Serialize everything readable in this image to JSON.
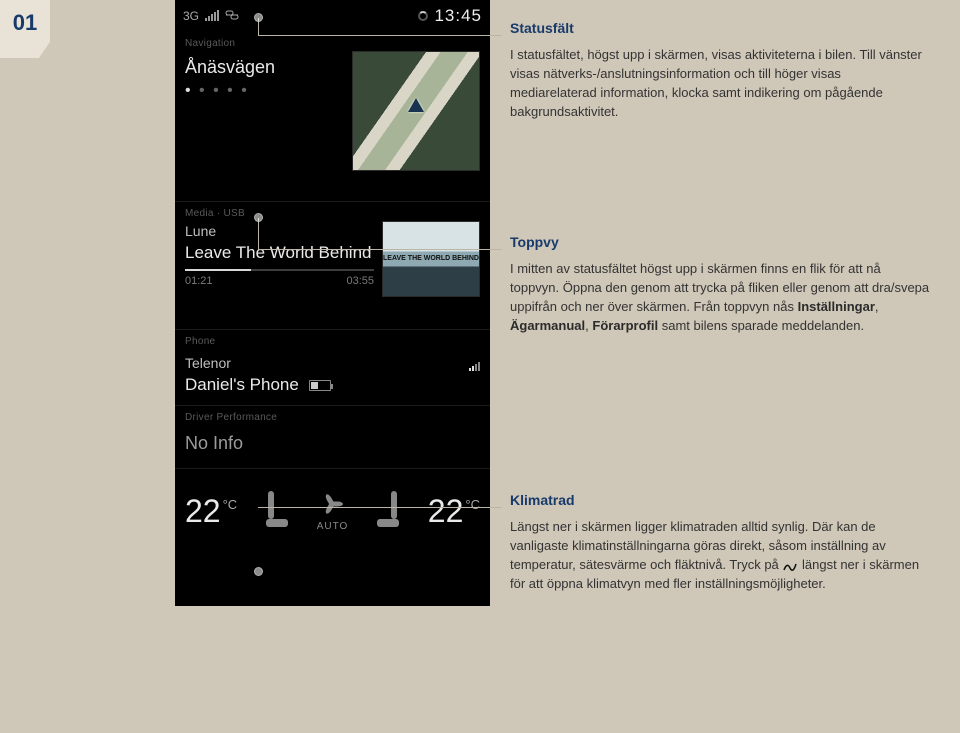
{
  "page_number": "01",
  "phone": {
    "status": {
      "conn_label": "3G",
      "time": "13:45"
    },
    "nav": {
      "label": "Navigation",
      "destination": "Ånäsvägen",
      "dots": "• • • • •"
    },
    "media": {
      "label": "Media · USB",
      "artist": "Lune",
      "track": "Leave The World Behind",
      "time_elapsed": "01:21",
      "time_total": "03:55",
      "art_caption": "LEAVE THE WORLD BEHIND"
    },
    "phone_tile": {
      "label": "Phone",
      "carrier": "Telenor",
      "name": "Daniel's Phone"
    },
    "perf": {
      "label": "Driver Performance",
      "value": "No Info"
    },
    "climate": {
      "left_temp": "22",
      "left_unit": "°C",
      "right_temp": "22",
      "right_unit": "°C",
      "fan_label": "AUTO"
    }
  },
  "sections": {
    "s1": {
      "title": "Statusfält",
      "body": "I statusfältet, högst upp i skärmen, visas aktiviteterna i bilen. Till vänster visas nätverks-/anslutningsinformation och till höger visas mediarelaterad information, klocka samt indikering om pågående bakgrundsaktivitet."
    },
    "s2": {
      "title": "Toppvy",
      "body_a": "I mitten av statusfältet högst upp i skärmen finns en flik för att nå toppvyn. Öppna den genom att trycka på fliken eller genom att dra/svepa uppifrån och ner över skärmen. Från toppvyn nås ",
      "bold1": "Inställningar",
      "body_b": ", ",
      "bold2": "Ägarmanual",
      "body_c": ", ",
      "bold3": "Förarprofil",
      "body_d": " samt bilens sparade meddelanden."
    },
    "s3": {
      "title": "Klimatrad",
      "body_a": "Längst ner i skärmen ligger klimatraden alltid synlig. Där kan de vanligaste klimatinställningarna göras direkt, såsom inställning av temperatur, sätesvärme och fläktnivå. Tryck på ",
      "body_b": " längst ner i skärmen för att öppna klimatvyn med fler inställningsmöjligheter."
    }
  }
}
